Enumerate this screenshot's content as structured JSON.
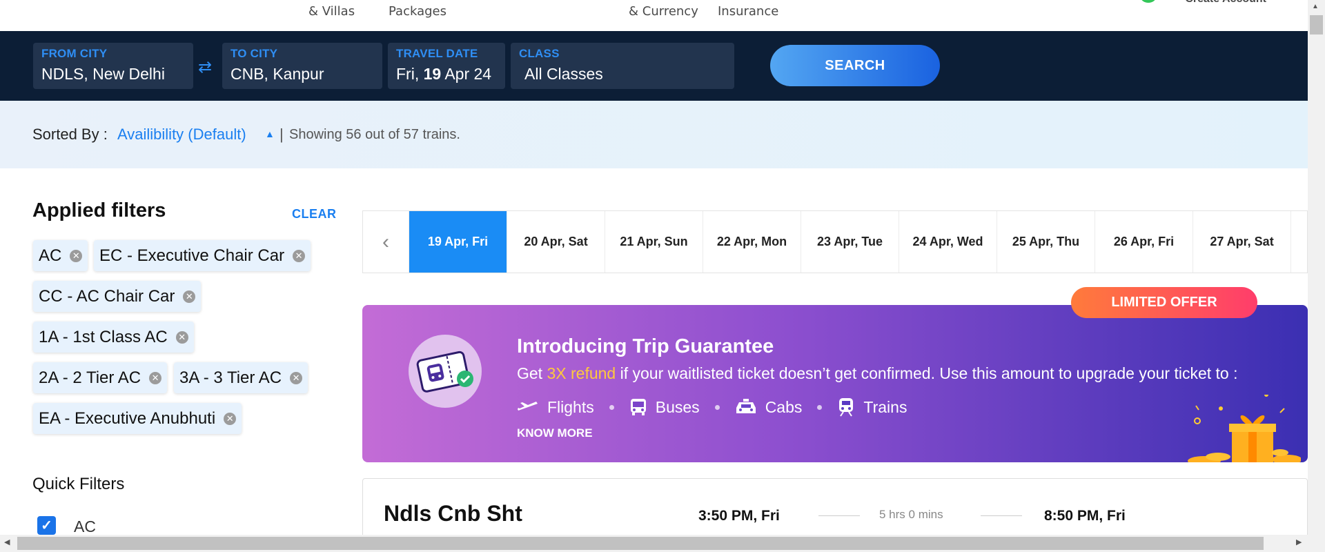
{
  "topnav": {
    "items": [
      {
        "line2": "& Villas"
      },
      {
        "line2": "Packages"
      },
      {
        "line2": "& Currency"
      },
      {
        "line2": "Insurance"
      }
    ],
    "create_account": "Create Account"
  },
  "search": {
    "from_label": "FROM CITY",
    "from_value": "NDLS, New Delhi",
    "swap_icon": "swap-arrows-icon",
    "to_label": "TO CITY",
    "to_value": "CNB, Kanpur",
    "date_label": "TRAVEL DATE",
    "date_prefix": "Fri,",
    "date_day": "19",
    "date_suffix": "Apr 24",
    "class_label": "CLASS",
    "class_value": "All Classes",
    "button": "SEARCH"
  },
  "sort": {
    "label": "Sorted By :",
    "value": "Availibility (Default)",
    "separator": "|",
    "showing": "Showing 56 out of 57 trains."
  },
  "filters": {
    "title": "Applied filters",
    "clear": "CLEAR",
    "chips": [
      "AC",
      "EC - Executive Chair Car",
      "CC - AC Chair Car",
      "1A - 1st Class AC",
      "2A - 2 Tier AC",
      "3A - 3 Tier AC",
      "EA - Executive Anubhuti"
    ],
    "quick_title": "Quick Filters",
    "quick_items": [
      {
        "label": "AC",
        "checked": true
      }
    ]
  },
  "dates": {
    "items": [
      {
        "label": "19 Apr, Fri",
        "active": true
      },
      {
        "label": "20 Apr, Sat"
      },
      {
        "label": "21 Apr, Sun"
      },
      {
        "label": "22 Apr, Mon"
      },
      {
        "label": "23 Apr, Tue"
      },
      {
        "label": "24 Apr, Wed"
      },
      {
        "label": "25 Apr, Thu"
      },
      {
        "label": "26 Apr, Fri"
      },
      {
        "label": "27 Apr, Sat"
      }
    ]
  },
  "promo": {
    "badge": "LIMITED OFFER",
    "title": "Introducing Trip Guarantee",
    "desc_pre": "Get ",
    "desc_highlight": "3X refund",
    "desc_post": " if your waitlisted ticket doesn’t get confirmed. Use this amount to upgrade your ticket to :",
    "modes": [
      "Flights",
      "Buses",
      "Cabs",
      "Trains"
    ],
    "know_more": "KNOW MORE",
    "colors": {
      "highlight": "#ffc93c",
      "gradient_start": "#c36cd6",
      "gradient_end": "#3b2fb2"
    }
  },
  "train": {
    "name": "Ndls Cnb Sht",
    "departure": "3:50 PM, Fri",
    "duration": "5 hrs 0 mins",
    "arrival": "8:50 PM, Fri"
  }
}
